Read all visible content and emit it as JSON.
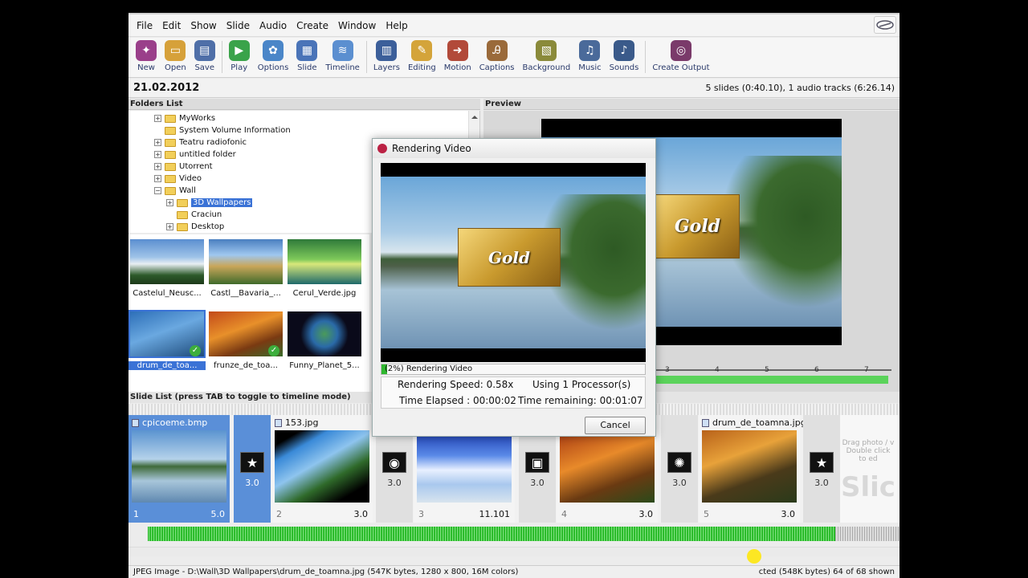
{
  "menu": [
    "File",
    "Edit",
    "Show",
    "Slide",
    "Audio",
    "Create",
    "Window",
    "Help"
  ],
  "toolbar": [
    {
      "label": "New",
      "icon": "new-icon",
      "color": "#9a3f8a"
    },
    {
      "label": "Open",
      "icon": "open-icon",
      "color": "#d6a13a"
    },
    {
      "label": "Save",
      "icon": "save-icon",
      "color": "#4f6fa8"
    },
    {
      "label": "Play",
      "icon": "play-icon",
      "color": "#3aa34a"
    },
    {
      "label": "Options",
      "icon": "options-icon",
      "color": "#4a86c8"
    },
    {
      "label": "Slide",
      "icon": "slide-icon",
      "color": "#4a74b8"
    },
    {
      "label": "Timeline",
      "icon": "timeline-icon",
      "color": "#5b8fd0"
    },
    {
      "label": "Layers",
      "icon": "layers-icon",
      "color": "#3c5f9a"
    },
    {
      "label": "Editing",
      "icon": "editing-icon",
      "color": "#d4a43a"
    },
    {
      "label": "Motion",
      "icon": "motion-icon",
      "color": "#b24a3a"
    },
    {
      "label": "Captions",
      "icon": "captions-icon",
      "color": "#9a6a3a"
    },
    {
      "label": "Background",
      "icon": "background-icon",
      "color": "#8a8a3a"
    },
    {
      "label": "Music",
      "icon": "music-icon",
      "color": "#4a6a9a"
    },
    {
      "label": "Sounds",
      "icon": "sounds-icon",
      "color": "#3a5a8a"
    },
    {
      "label": "Create Output",
      "icon": "disc-icon",
      "color": "#7a3a6a"
    }
  ],
  "info": {
    "date": "21.02.2012",
    "summary": "5 slides (0:40.10), 1 audio tracks (6:26.14)"
  },
  "folders_header": "Folders List",
  "folders": [
    {
      "label": "MyWorks",
      "level": 1,
      "expander": "+"
    },
    {
      "label": "System Volume Information",
      "level": 1,
      "expander": ""
    },
    {
      "label": "Teatru radiofonic",
      "level": 1,
      "expander": "+"
    },
    {
      "label": "untitled folder",
      "level": 1,
      "expander": "+"
    },
    {
      "label": "Utorrent",
      "level": 1,
      "expander": "+"
    },
    {
      "label": "Video",
      "level": 1,
      "expander": "+"
    },
    {
      "label": "Wall",
      "level": 1,
      "expander": "−"
    },
    {
      "label": "3D Wallpapers",
      "level": 2,
      "expander": "+",
      "selected": true
    },
    {
      "label": "Craciun",
      "level": 2,
      "expander": ""
    },
    {
      "label": "Desktop",
      "level": 2,
      "expander": "+"
    }
  ],
  "thumbnails": [
    {
      "caption": "Castelul_Neusc...",
      "checked": false,
      "selected": false
    },
    {
      "caption": "Castl__Bavaria_...",
      "checked": false,
      "selected": false
    },
    {
      "caption": "Cerul_Verde.jpg",
      "checked": false,
      "selected": false
    },
    {
      "caption": "drum_de_toa...",
      "checked": true,
      "selected": true
    },
    {
      "caption": "frunze_de_toa...",
      "checked": true,
      "selected": false
    },
    {
      "caption": "Funny_Planet_5...",
      "checked": false,
      "selected": false
    }
  ],
  "preview_header": "Preview",
  "preview": {
    "logo_text": "Gold",
    "ruler": [
      "3",
      "4",
      "5",
      "6",
      "7"
    ]
  },
  "slide_list_header": "Slide List (press TAB to toggle to timeline mode)",
  "slides": [
    {
      "title": "cpicoeme.bmp",
      "num": "1",
      "duration": "5.0",
      "selected": true
    },
    {
      "title": "153.jpg",
      "num": "2",
      "duration": "3.0",
      "selected": false
    },
    {
      "title": "",
      "num": "3",
      "duration": "11.101",
      "selected": false
    },
    {
      "title": "",
      "num": "4",
      "duration": "3.0",
      "selected": false
    },
    {
      "title": "drum_de_toamna.jpg",
      "num": "5",
      "duration": "3.0",
      "selected": false
    }
  ],
  "transitions": [
    {
      "duration": "3.0",
      "icon": "star-transition-icon",
      "glyph": "★",
      "selected": true
    },
    {
      "duration": "3.0",
      "icon": "fade-transition-icon",
      "glyph": "◉",
      "selected": false
    },
    {
      "duration": "3.0",
      "icon": "shape-transition-icon",
      "glyph": "▣",
      "selected": false
    },
    {
      "duration": "3.0",
      "icon": "spiral-transition-icon",
      "glyph": "✺",
      "selected": false
    },
    {
      "duration": "3.0",
      "icon": "star-transition-icon",
      "glyph": "★",
      "selected": false
    }
  ],
  "drag_hint": {
    "line1": "Drag photo / v",
    "line2": "Double click",
    "line3": "to ed",
    "big": "Slic"
  },
  "status": {
    "left": "JPEG Image - D:\\Wall\\3D Wallpapers\\drum_de_toamna.jpg  (547K bytes, 1280 x 800, 16M colors)",
    "right": "cted (548K bytes) 64 of 68 shown"
  },
  "dialog": {
    "title": "Rendering Video",
    "progress_percent": 2,
    "progress_text": "(2%) Rendering Video",
    "speed": "Rendering Speed: 0.58x",
    "processors": "Using 1 Processor(s)",
    "elapsed": "Time Elapsed  :  00:00:02",
    "remaining": "Time remaining: 00:01:07",
    "cancel": "Cancel",
    "logo_text": "Gold"
  }
}
